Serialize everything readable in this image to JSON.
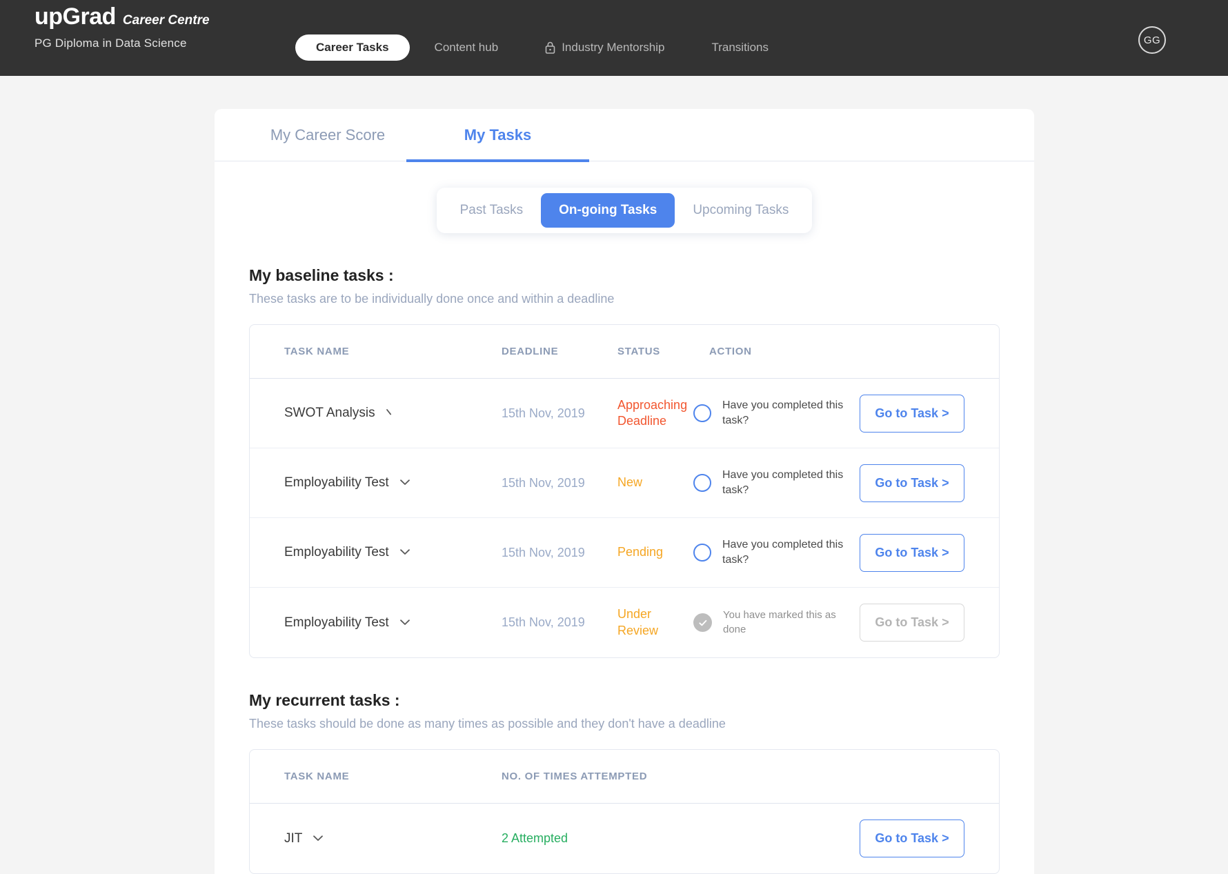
{
  "topbar": {
    "brand_name": "upGrad",
    "brand_sub": "Career Centre",
    "course": "PG Diploma in Data Science",
    "nav": [
      {
        "label": "Career Tasks",
        "active": true,
        "icon": null
      },
      {
        "label": "Content hub",
        "active": false,
        "icon": null
      },
      {
        "label": "Industry Mentorship",
        "active": false,
        "icon": "lock-icon"
      },
      {
        "label": "Transitions",
        "active": false,
        "icon": null
      }
    ],
    "avatar_initials": "GG",
    "bg_color": "#333333"
  },
  "tabs": [
    {
      "label": "My Career Score",
      "active": false
    },
    {
      "label": "My Tasks",
      "active": true
    }
  ],
  "filters": [
    {
      "label": "Past Tasks",
      "active": false
    },
    {
      "label": "On-going Tasks",
      "active": true
    },
    {
      "label": "Upcoming Tasks",
      "active": false
    }
  ],
  "baseline": {
    "title": "My baseline tasks :",
    "subtitle": "These tasks are to be individually done once and within a deadline",
    "columns": [
      "TASK NAME",
      "DEADLINE",
      "STATUS",
      "ACTION"
    ],
    "rows": [
      {
        "name": "SWOT Analysis",
        "chevron": "chevron-partial-icon",
        "deadline": "15th Nov, 2019",
        "status": "Approaching Deadline",
        "status_color": "#f2562f",
        "action_text": "Have you completed this task?",
        "marker": "radio",
        "button": "Go to Task >",
        "button_disabled": false
      },
      {
        "name": "Employability Test",
        "chevron": "chevron-down-icon",
        "deadline": "15th Nov, 2019",
        "status": "New",
        "status_color": "#f5a623",
        "action_text": "Have you completed this task?",
        "marker": "radio",
        "button": "Go to Task >",
        "button_disabled": false
      },
      {
        "name": "Employability Test",
        "chevron": "chevron-down-icon",
        "deadline": "15th Nov, 2019",
        "status": "Pending",
        "status_color": "#f5a623",
        "action_text": "Have you completed this task?",
        "marker": "radio",
        "button": "Go to Task >",
        "button_disabled": false
      },
      {
        "name": "Employability Test",
        "chevron": "chevron-down-icon",
        "deadline": "15th Nov, 2019",
        "status": "Under Review",
        "status_color": "#f5a623",
        "action_text": "You have marked this as done",
        "marker": "check",
        "button": "Go to Task >",
        "button_disabled": true
      }
    ]
  },
  "recurrent": {
    "title": "My recurrent tasks :",
    "subtitle": "These tasks should be done as many times as possible and they don't have a deadline",
    "columns": [
      "TASK NAME",
      "NO. OF TIMES ATTEMPTED"
    ],
    "rows": [
      {
        "name": "JIT",
        "chevron": "chevron-down-icon",
        "attempted": "2 Attempted",
        "attempted_color": "#27ae60",
        "button": "Go to Task >",
        "button_disabled": false
      }
    ]
  },
  "colors": {
    "accent_blue": "#4e84ec",
    "page_bg": "#f4f4f4",
    "muted_blue": "#9aaac7"
  }
}
